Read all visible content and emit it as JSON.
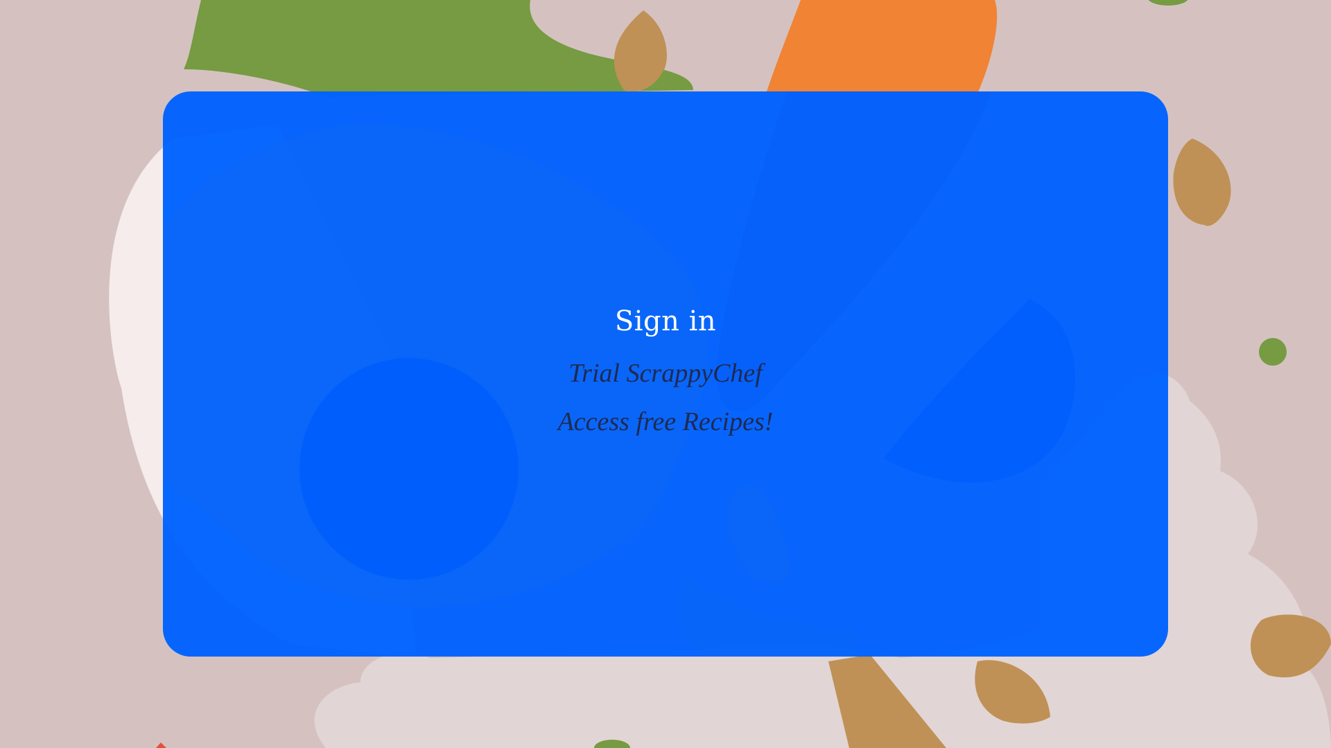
{
  "login": {
    "title": "Sign in",
    "line1": "Trial ScrappyChef",
    "line2": "Access free Recipes!"
  },
  "colors": {
    "card": "#0062ff",
    "page_background": "#d5c2c0",
    "title_text": "#ffffff",
    "tagline_text": "#1e2a52"
  }
}
